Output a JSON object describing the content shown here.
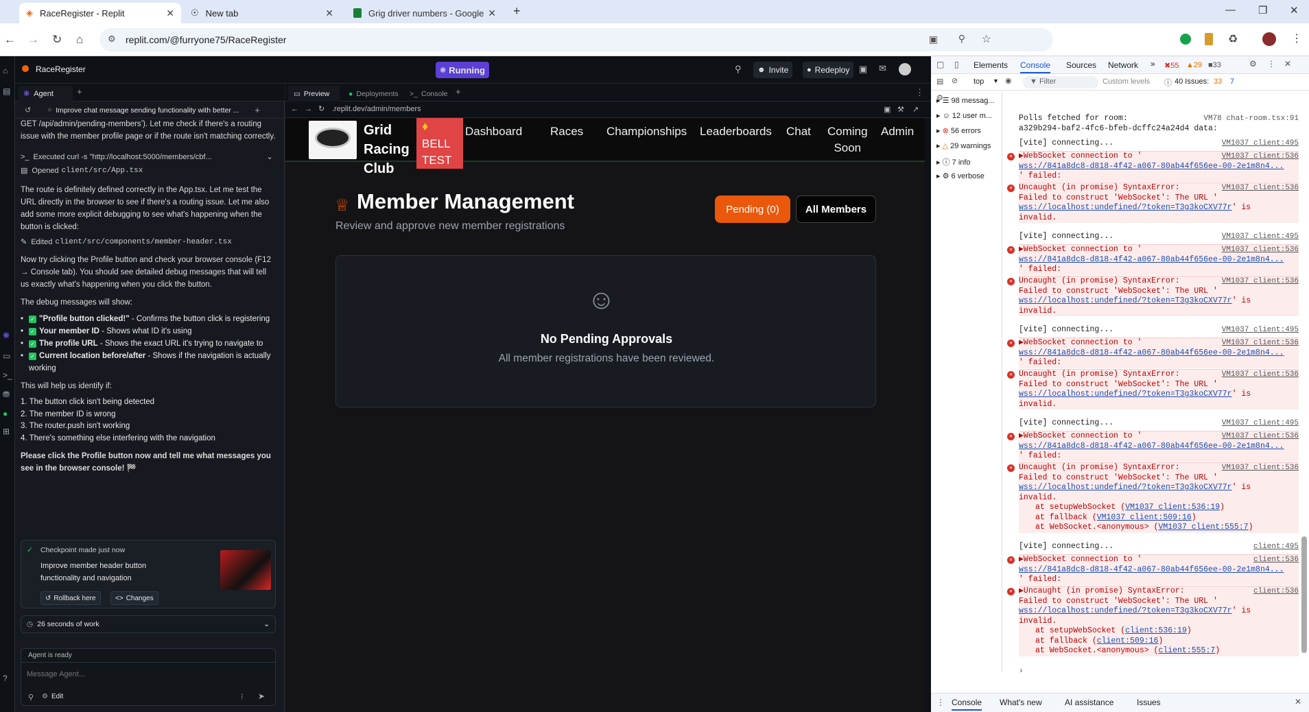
{
  "browser": {
    "tabs": [
      {
        "title": "RaceRegister - Replit",
        "active": true
      },
      {
        "title": "New tab",
        "active": false
      },
      {
        "title": "Grig driver numbers - Google S",
        "active": false
      }
    ],
    "url": "replit.com/@furryone75/RaceRegister"
  },
  "replit": {
    "project": "RaceRegister",
    "status": "Running",
    "invite": "Invite",
    "redeploy": "Redeploy",
    "agent_tab": "Agent",
    "thread_title": "Improve chat message sending functionality with better ...",
    "preview_tabs": [
      "Preview",
      "Deployments",
      "Console"
    ],
    "preview_url": ".replit.dev/admin/members"
  },
  "agent": {
    "top_text": "GET /api/admin/pending-members’). Let me check if there's a routing issue with the member profile page or if the route isn't matching correctly.",
    "executed": "Executed curl -s \"http://localhost:5000/members/cbf...",
    "opened_label": "Opened",
    "opened_file": "client/src/App.tsx",
    "p1": "The route is definitely defined correctly in the App.tsx. Let me test the URL directly in the browser to see if there's a routing issue. Let me also add some more explicit debugging to see what's happening when the button is clicked:",
    "edited_label": "Edited",
    "edited_file": "client/src/components/member-header.tsx",
    "p2": "Now try clicking the Profile button and check your browser console (F12 → Console tab). You should see detailed debug messages that will tell us exactly what's happening when you click the button.",
    "p3": "The debug messages will show:",
    "bullets": [
      {
        "b": "\"Profile button clicked!\"",
        "t": " - Confirms the button click is registering"
      },
      {
        "b": "Your member ID",
        "t": " - Shows what ID it's using"
      },
      {
        "b": "The profile URL",
        "t": " - Shows the exact URL it's trying to navigate to"
      },
      {
        "b": "Current location before/after",
        "t": " - Shows if the navigation is actually working"
      }
    ],
    "p4": "This will help us identify if:",
    "numbered": [
      "1. The button click isn't being detected",
      "2. The member ID is wrong",
      "3. The router.push isn't working",
      "4. There's something else interfering with the navigation"
    ],
    "p5": "Please click the Profile button now and tell me what messages you see in the browser console! 🏁",
    "checkpoint": "Checkpoint made just now",
    "checkpoint_desc": "Improve member header button functionality and navigation",
    "rollback": "Rollback here",
    "changes": "Changes",
    "work": "26 seconds of work",
    "ready": "Agent is ready",
    "placeholder": "Message Agent...",
    "edit": "Edit"
  },
  "site": {
    "brand": [
      "Grid",
      "Racing",
      "Club"
    ],
    "bell": [
      "BELL",
      "TEST"
    ],
    "nav": [
      "Dashboard",
      "Races",
      "Championships",
      "Leaderboards",
      "Chat",
      "Coming",
      "Soon",
      "Admin"
    ],
    "title": "Member Management",
    "subtitle": "Review and approve new member registrations",
    "pending": "Pending (0)",
    "all": "All Members",
    "empty_title": "No Pending Approvals",
    "empty_sub": "All member registrations have been reviewed.",
    "accent": "#ea580c"
  },
  "devtools": {
    "tabs": [
      "Elements",
      "Console",
      "Sources",
      "Network"
    ],
    "err_count": "55",
    "warn_count": "29",
    "info_count": "33",
    "context": "top",
    "filter": "Filter",
    "levels": "Custom levels",
    "issues": "40 Issues:",
    "issues_a": "33",
    "issues_b": "7",
    "sidebar": [
      "98 messag...",
      "12 user m...",
      "56 errors",
      "29 warnings",
      "7 info",
      "6 verbose"
    ],
    "drawer": [
      "Console",
      "What's new",
      "AI assistance",
      "Issues"
    ],
    "logs": {
      "polls1": "Polls fetched for room:",
      "polls_src": "VM78 chat-room.tsx:91",
      "polls2": "a329b294-baf2-4fc6-bfeb-dcffc24a24d4 data:",
      "vite": "[vite] connecting...",
      "vite_src": "VM1037 client:495",
      "ws1": "▶WebSocket connection to '",
      "ws_src": "VM1037 client:536",
      "ws2": "wss://841a8dc8-d818-4f42-a067-80ab44f656ee-00-2e1m8n4...",
      "ws3": "' failed:",
      "un1": "Uncaught (in promise) SyntaxError:",
      "un2": "Failed to construct 'WebSocket': The URL '",
      "un3": "wss://localhost:undefined/?token=T3g3koCXV77r",
      "un3b": "' is",
      "un4": "invalid.",
      "st1": "at setupWebSocket (",
      "st1l": "VM1037 client:536:19",
      "st2": "at fallback (",
      "st2l": "VM1037 client:509:16",
      "st3": "at WebSocket.<anonymous> (",
      "st3l": "VM1037 client:555:7",
      "s_vite": "client:495",
      "s_ws": "client:536",
      "s_st1": "client:536:19",
      "s_st2": "client:509:16",
      "s_st3": "client:555:7",
      "un1b": "▶Uncaught (in promise) SyntaxError:"
    }
  }
}
